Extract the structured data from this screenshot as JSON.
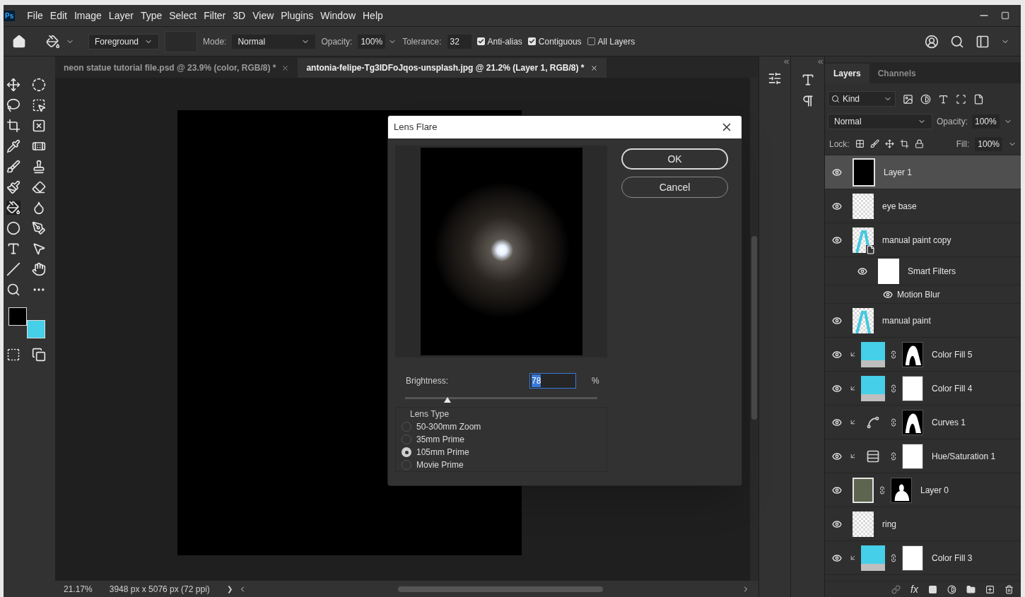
{
  "menu": [
    "File",
    "Edit",
    "Image",
    "Layer",
    "Type",
    "Select",
    "Filter",
    "3D",
    "View",
    "Plugins",
    "Window",
    "Help"
  ],
  "app_logo": "Ps",
  "options": {
    "preset": "Foreground",
    "mode_label": "Mode:",
    "mode": "Normal",
    "opacity_label": "Opacity:",
    "opacity": "100%",
    "tolerance_label": "Tolerance:",
    "tolerance": "32",
    "checks": [
      {
        "label": "Anti-alias",
        "checked": true
      },
      {
        "label": "Contiguous",
        "checked": true
      },
      {
        "label": "All Layers",
        "checked": false
      }
    ]
  },
  "tabs": [
    {
      "label": "neon statue tutorial file.psd @ 23.9% (color, RGB/8) *",
      "selected": false
    },
    {
      "label": "antonia-felipe-Tg3IDFoJqos-unsplash.jpg @ 21.2% (Layer 1, RGB/8) *",
      "selected": true
    }
  ],
  "status": {
    "zoom": "21.17%",
    "size": "3948 px x 5076 px (72 ppi)",
    "arrow": "❯"
  },
  "dialog": {
    "title": "Lens Flare",
    "buttons": [
      {
        "label": "OK",
        "default": true
      },
      {
        "label": "Cancel",
        "default": false
      }
    ],
    "brightness_label": "Brightness:",
    "brightness": "78",
    "unit": "%",
    "level": 0.22,
    "lens_type_label": "Lens Type",
    "lens_types": [
      {
        "label": "50-300mm Zoom",
        "selected": false
      },
      {
        "label": "35mm Prime",
        "selected": false
      },
      {
        "label": "105mm Prime",
        "selected": true
      },
      {
        "label": "Movie Prime",
        "selected": false
      }
    ]
  },
  "layers_panel": {
    "tabs": [
      {
        "label": "Layers",
        "selected": true
      },
      {
        "label": "Channels",
        "selected": false
      }
    ],
    "filter": "Kind",
    "blend": "Normal",
    "opacity_label": "Opacity:",
    "opacity": "100%",
    "lock_label": "Lock:",
    "fill_label": "Fill:",
    "fill": "100%",
    "layers": [
      {
        "name": "Layer 1",
        "kind": "black",
        "selected": true,
        "clipped": false
      },
      {
        "name": "eye base",
        "kind": "empty",
        "selected": false,
        "clipped": false
      },
      {
        "name": "manual paint copy",
        "kind": "smart",
        "selected": false,
        "clipped": false,
        "children": [
          {
            "name": "Smart Filters",
            "kind": "smart_filters",
            "selected": false,
            "clipped": false,
            "children": [
              {
                "name": "Motion Blur",
                "kind": "filter",
                "selected": false,
                "clipped": false
              }
            ]
          }
        ]
      },
      {
        "name": "manual paint",
        "kind": "paint",
        "selected": false,
        "clipped": false
      },
      {
        "name": "Color Fill 5",
        "kind": "color_fill",
        "mask": {
          "kind": "shape"
        },
        "selected": false,
        "clipped": true
      },
      {
        "name": "Color Fill 4",
        "kind": "color_fill",
        "mask": {
          "kind": "white"
        },
        "selected": false,
        "clipped": true
      },
      {
        "name": "Curves 1",
        "kind": "curves",
        "mask": {
          "kind": "shape"
        },
        "selected": false,
        "clipped": true
      },
      {
        "name": "Hue/Saturation 1",
        "kind": "hue_sat",
        "mask": {
          "kind": "white"
        },
        "selected": false,
        "clipped": true
      },
      {
        "name": "Layer 0",
        "kind": "photo",
        "mask": {
          "kind": "silhouette"
        },
        "selected": false,
        "clipped": false
      },
      {
        "name": "ring",
        "kind": "empty",
        "selected": false,
        "clipped": false
      },
      {
        "name": "Color Fill 3",
        "kind": "color_fill",
        "mask": {
          "kind": "white"
        },
        "selected": false,
        "clipped": true
      }
    ],
    "footer_fx": "fx"
  }
}
